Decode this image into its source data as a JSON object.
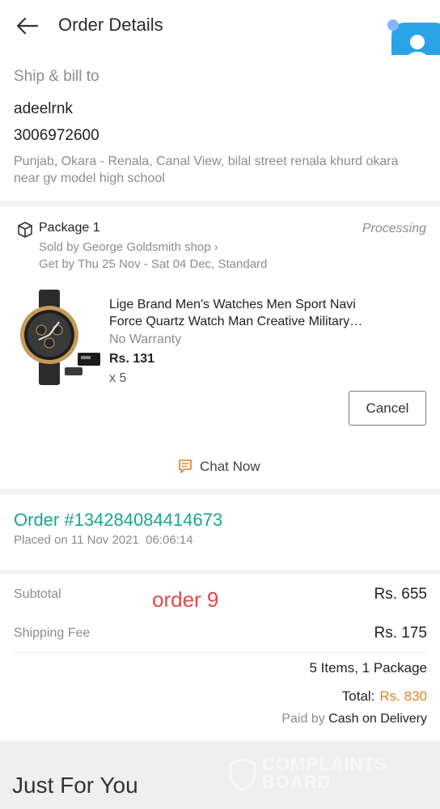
{
  "header": {
    "title": "Order Details"
  },
  "shipping": {
    "label": "Ship & bill to",
    "name": "adeelrnk",
    "phone": "3006972600",
    "address": "Punjab, Okara - Renala, Canal View, bilal street renala khurd okara near gv model high school"
  },
  "package": {
    "label": "Package 1",
    "status": "Processing",
    "seller": "Sold by George Goldsmith shop ›",
    "delivery": "Get by Thu 25 Nov - Sat 04 Dec, Standard",
    "item": {
      "name": "Lige Brand Men's Watches Men Sport Navi Force Quartz Watch Man Creative Military…",
      "warranty": "No Warranty",
      "price": "Rs. 131",
      "quantity": "x 5"
    },
    "cancel_label": "Cancel",
    "chat_label": "Chat Now"
  },
  "order": {
    "number": "Order #134284084414673",
    "placed": "Placed on 11 Nov 2021  06:06:14"
  },
  "summary": {
    "subtotal_label": "Subtotal",
    "subtotal_value": "Rs. 655",
    "annotation": "order 9",
    "shipping_label": "Shipping Fee",
    "shipping_value": "Rs. 175",
    "items_text": "5 Items, 1 Package",
    "total_label": "Total:",
    "total_value": "Rs. 830",
    "paid_by_label": "Paid by",
    "payment_method": "Cash on Delivery"
  },
  "recommend": {
    "title": "Just For You"
  },
  "watermark": {
    "line1": "COMPLAINTS",
    "line2": "BOARD"
  },
  "colors": {
    "accent_green": "#1aa68e",
    "total_orange": "#e77f24",
    "annotation_red": "#de4a4a"
  }
}
